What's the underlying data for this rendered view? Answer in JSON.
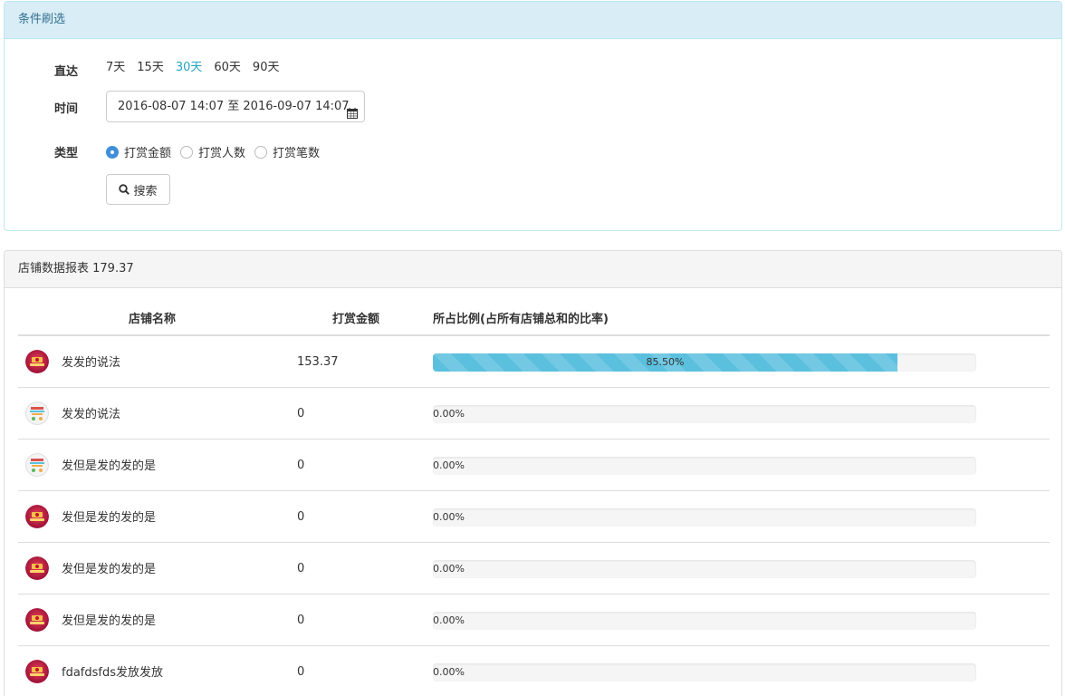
{
  "filter_panel": {
    "title": "条件刷选",
    "quick_label": "直达",
    "quick_links": [
      {
        "label": "7天",
        "active": false
      },
      {
        "label": "15天",
        "active": false
      },
      {
        "label": "30天",
        "active": true
      },
      {
        "label": "60天",
        "active": false
      },
      {
        "label": "90天",
        "active": false
      }
    ],
    "time_label": "时间",
    "date_range": "2016-08-07 14:07 至 2016-09-07 14:07",
    "type_label": "类型",
    "types": [
      {
        "label": "打赏金额",
        "checked": true
      },
      {
        "label": "打赏人数",
        "checked": false
      },
      {
        "label": "打赏笔数",
        "checked": false
      }
    ],
    "search_button": "搜索",
    "icons": {
      "calendar": "calendar-icon",
      "search": "search-icon"
    }
  },
  "report_panel": {
    "title": "店铺数据报表 179.37",
    "columns": [
      "店铺名称",
      "打赏金额",
      "所占比例(占所有店铺总和的比率)"
    ],
    "rows": [
      {
        "avatar": "red",
        "name": "发发的说法",
        "amount": "153.37",
        "percent": 85.5,
        "percent_label": "85.50%"
      },
      {
        "avatar": "white",
        "name": "发发的说法",
        "amount": "0",
        "percent": 0,
        "percent_label": "0.00%"
      },
      {
        "avatar": "white",
        "name": "发但是发的发的是",
        "amount": "0",
        "percent": 0,
        "percent_label": "0.00%"
      },
      {
        "avatar": "red",
        "name": "发但是发的发的是",
        "amount": "0",
        "percent": 0,
        "percent_label": "0.00%"
      },
      {
        "avatar": "red",
        "name": "发但是发的发的是",
        "amount": "0",
        "percent": 0,
        "percent_label": "0.00%"
      },
      {
        "avatar": "red",
        "name": "发但是发的发的是",
        "amount": "0",
        "percent": 0,
        "percent_label": "0.00%"
      },
      {
        "avatar": "red",
        "name": "fdafdsfds发放发放",
        "amount": "0",
        "percent": 0,
        "percent_label": "0.00%"
      }
    ]
  },
  "colors": {
    "accent": "#23a6c4",
    "progress": "#5bc0de",
    "radio_checked": "#3f8fd9",
    "filter_heading_bg": "#d9edf7",
    "filter_heading_text": "#31708f"
  }
}
